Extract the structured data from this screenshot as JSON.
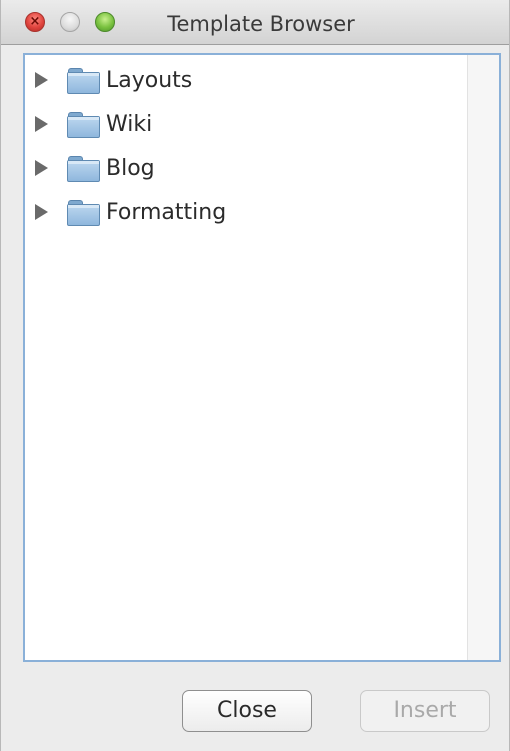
{
  "window": {
    "title": "Template Browser"
  },
  "tree": {
    "items": [
      {
        "label": "Layouts",
        "icon": "folder-icon",
        "expanded": false
      },
      {
        "label": "Wiki",
        "icon": "folder-icon",
        "expanded": false
      },
      {
        "label": "Blog",
        "icon": "folder-icon",
        "expanded": false
      },
      {
        "label": "Formatting",
        "icon": "folder-icon",
        "expanded": false
      }
    ]
  },
  "buttons": {
    "close_label": "Close",
    "insert_label": "Insert",
    "insert_enabled": false
  },
  "colors": {
    "accent_border": "#8ab0d8",
    "close_traffic": "#e0443e",
    "zoom_traffic": "#79c13f"
  }
}
